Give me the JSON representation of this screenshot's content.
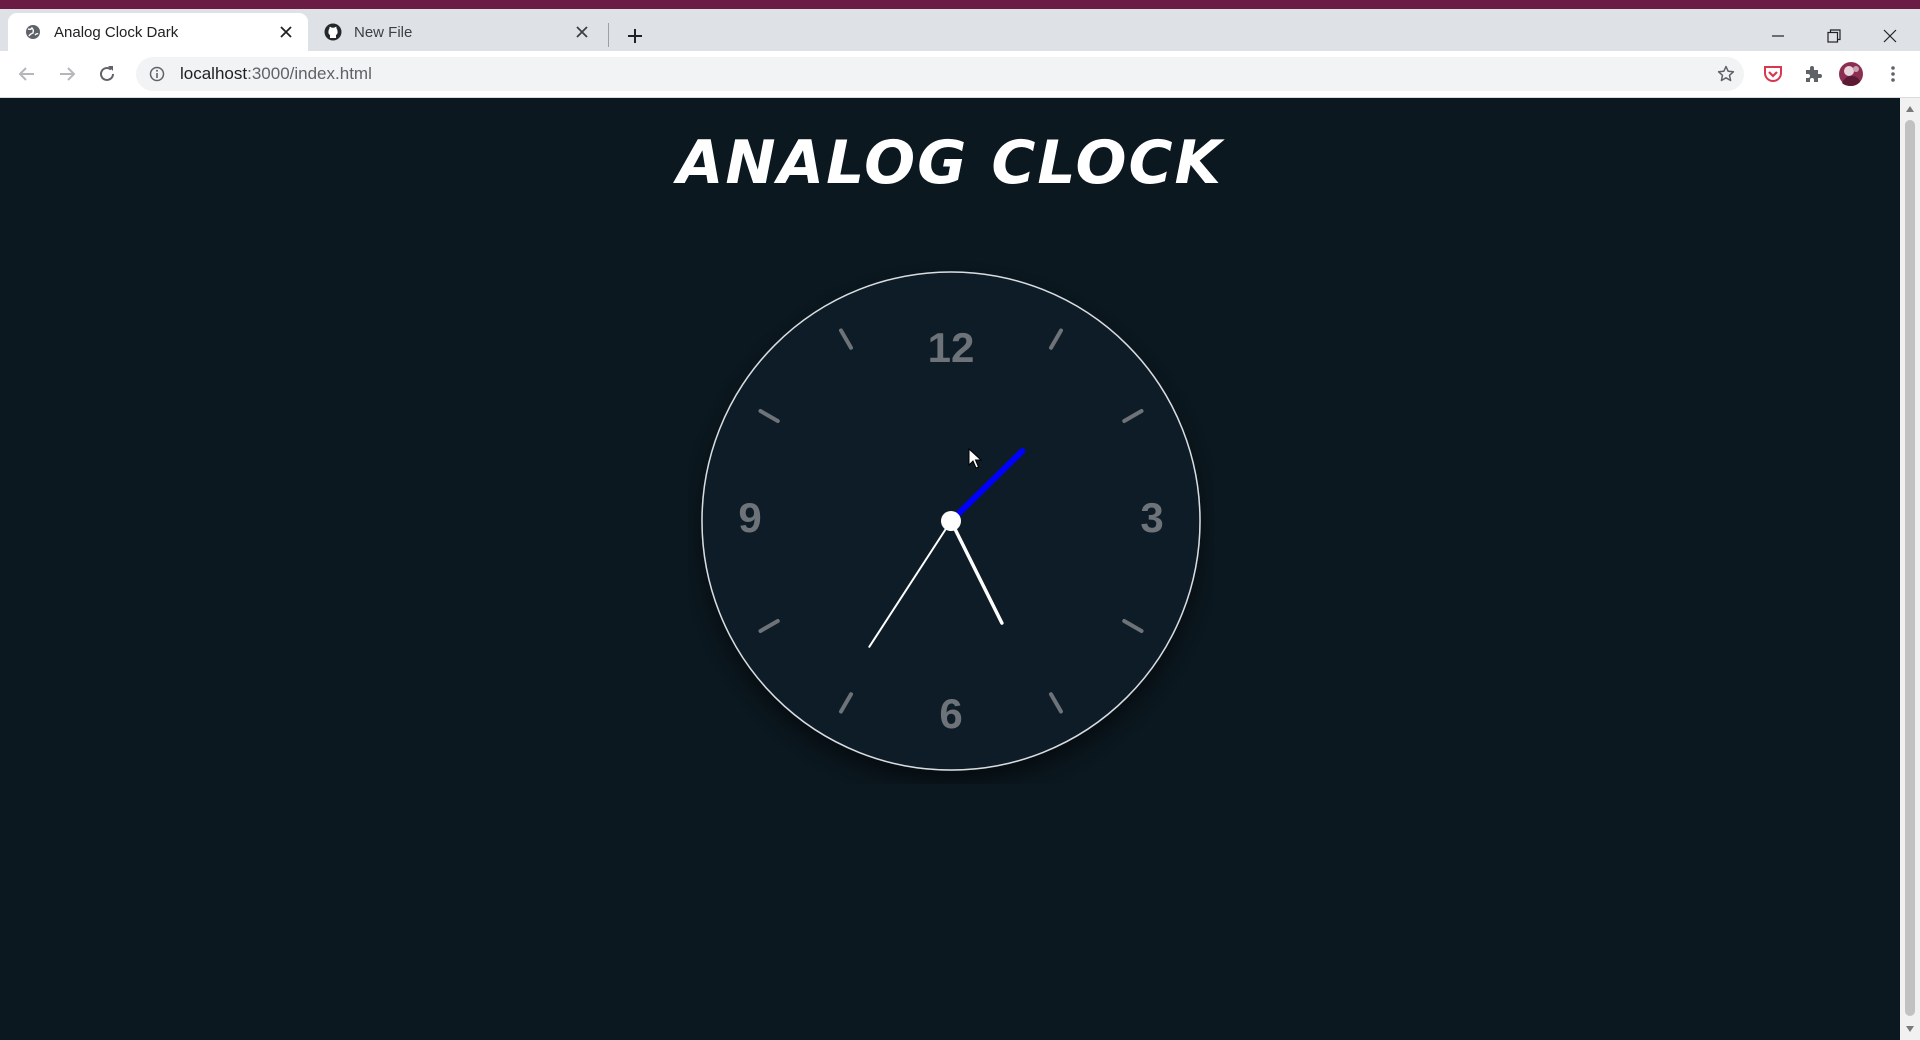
{
  "browser": {
    "tabs": [
      {
        "title": "Analog Clock Dark",
        "icon": "globe-icon",
        "active": true
      },
      {
        "title": "New File",
        "icon": "github-icon",
        "active": false
      }
    ],
    "url_host": "localhost",
    "url_rest": ":3000/index.html"
  },
  "page": {
    "title": "ANALOG CLOCK"
  },
  "clock": {
    "numbers": {
      "top": "12",
      "right": "3",
      "bottom": "6",
      "left": "9"
    },
    "time": {
      "hour": 5,
      "minute": 7,
      "second": 35.5
    },
    "colors": {
      "face": "#101c26",
      "rim": "#d8dde2",
      "numbers": "#6d7378",
      "ticks": "#6d7378",
      "hour_hand": "#ffffff",
      "minute_hand": "#0000ff",
      "second_hand": "#ffffff"
    }
  },
  "colors": {
    "page_background": "#0b1820",
    "topstrip": "#6b1c44"
  }
}
